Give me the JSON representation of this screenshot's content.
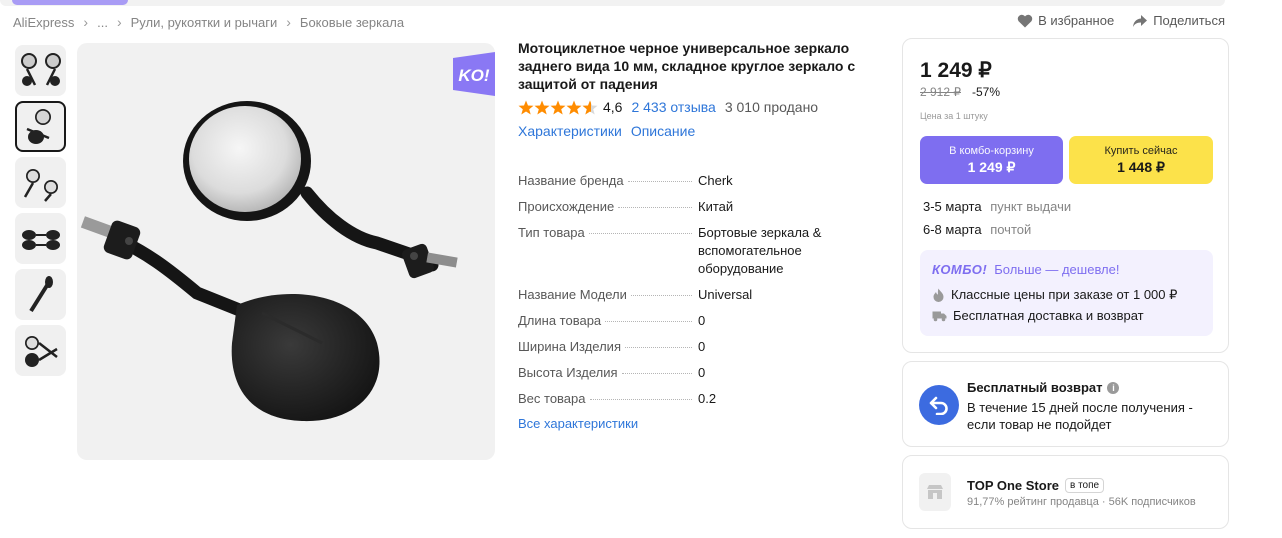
{
  "breadcrumb": {
    "items": [
      "AliExpress",
      "...",
      "Рули, рукоятки и рычаги",
      "Боковые зеркала"
    ]
  },
  "top_actions": {
    "favorite": "В избранное",
    "share": "Поделиться"
  },
  "product": {
    "title": "Мотоциклетное черное универсальное зеркало заднего вида 10 мм, складное круглое зеркало с защитой от падения",
    "rating": "4,6",
    "rating_fraction": 0.92,
    "reviews": "2 433 отзыва",
    "sold": "3 010 продано",
    "tabs": [
      "Характеристики",
      "Описание"
    ],
    "ko_badge": "KO!"
  },
  "specs": [
    {
      "name": "Название бренда",
      "value": "Cherk"
    },
    {
      "name": "Происхождение",
      "value": "Китай"
    },
    {
      "name": "Тип товара",
      "value": "Бортовые зеркала & вспомогательное оборудование"
    },
    {
      "name": "Название Модели",
      "value": "Universal"
    },
    {
      "name": "Длина товара",
      "value": "0"
    },
    {
      "name": "Ширина Изделия",
      "value": "0"
    },
    {
      "name": "Высота Изделия",
      "value": "0"
    },
    {
      "name": "Вес товара",
      "value": "0.2"
    }
  ],
  "all_specs_link": "Все характеристики",
  "pricing": {
    "price": "1 249 ₽",
    "old_price": "2 912 ₽",
    "discount": "-57%",
    "per_unit": "Цена за 1 штуку",
    "combo_button": {
      "label": "В комбо-корзину",
      "price": "1 249 ₽"
    },
    "buy_button": {
      "label": "Купить сейчас",
      "price": "1 448 ₽"
    }
  },
  "delivery": [
    {
      "date": "3-5 марта",
      "method": "пункт выдачи"
    },
    {
      "date": "6-8 марта",
      "method": "почтой"
    }
  ],
  "combo": {
    "logo": "КОМБО!",
    "headline": "Больше — дешевле!",
    "lines": [
      "Классные цены при заказе от 1 000 ₽",
      "Бесплатная доставка и возврат"
    ]
  },
  "returns": {
    "title": "Бесплатный возврат",
    "text": "В течение 15 дней после получения - если товар не подойдет"
  },
  "store": {
    "name": "TOP One Store",
    "badge": "в топе",
    "stats": "91,77% рейтинг продавца · 56K подписчиков"
  },
  "colors": {
    "link": "#2e76d9",
    "combo_purple": "#7e6ef0",
    "buy_yellow": "#fce24a",
    "star_orange": "#ff8c00",
    "return_blue": "#3c6be0"
  }
}
